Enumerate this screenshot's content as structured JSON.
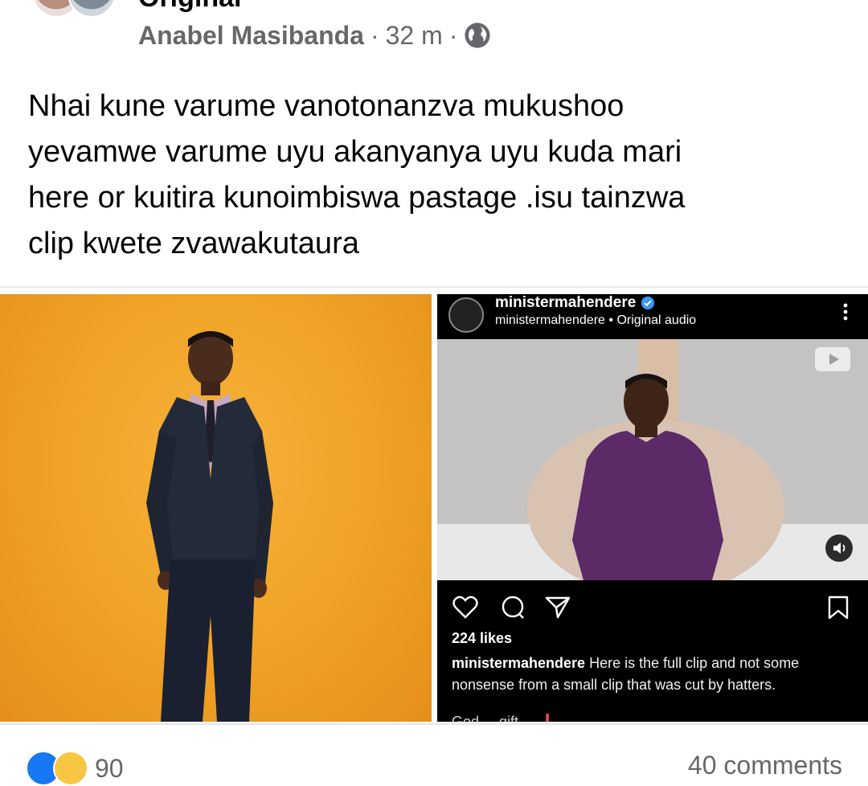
{
  "header": {
    "title_partial": "Original",
    "author": "Anabel Masibanda",
    "sep1": "·",
    "time": "32 m",
    "sep2": "·",
    "privacy_icon": "globe-icon"
  },
  "post": {
    "lines": [
      "Nhai kune varume vanotonanzva mukushoo",
      "yevamwe varume uyu akanyanya uyu kuda mari",
      "here or kuitira kunoimbiswa pastage .isu tainzwa",
      "clip kwete zvawakutaura"
    ]
  },
  "instagram": {
    "username": "ministermahendere",
    "subline": "ministermahendere • Original audio",
    "likes": "224 likes",
    "caption_user": "ministermahendere",
    "caption_text": " Here is the full clip and not some nonsense from a small clip that was cut by hatters.",
    "caption_more": "God ... gift ... ❗"
  },
  "footer": {
    "reaction_count": "90",
    "comments": "40 comments"
  },
  "colors": {
    "meta_gray": "#65676b",
    "orange_bg": "#f0a528",
    "like_blue": "#1877f2",
    "verified_blue": "#3897f0",
    "shirt_purple": "#5b2a67"
  }
}
